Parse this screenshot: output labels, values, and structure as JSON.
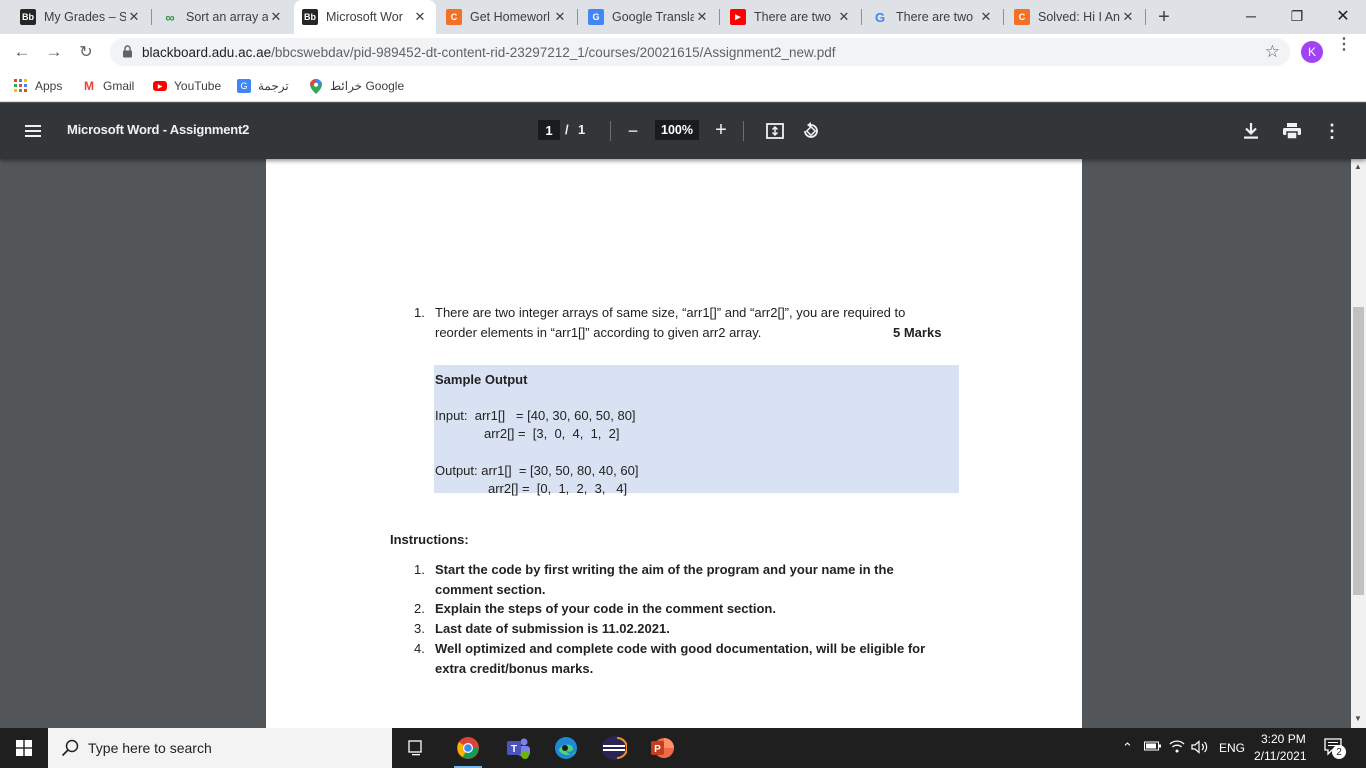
{
  "tabs": [
    {
      "title": "My Grades – S",
      "favicon": "Bb",
      "favicon_color": "#262626"
    },
    {
      "title": "Sort an array a",
      "favicon": "∞",
      "favicon_color": "#2f8d46"
    },
    {
      "title": "Microsoft Wor",
      "favicon": "Bb",
      "favicon_color": "#262626",
      "active": true
    },
    {
      "title": "Get Homeworl",
      "favicon": "C",
      "favicon_color": "#f37024"
    },
    {
      "title": "Google Transla",
      "favicon": "G",
      "favicon_color": "#4285f4"
    },
    {
      "title": "There are two",
      "favicon": "▶",
      "favicon_color": "#ff0000"
    },
    {
      "title": "There are two",
      "favicon": "G",
      "favicon_color": "#4285f4"
    },
    {
      "title": "Solved: Hi I An",
      "favicon": "C",
      "favicon_color": "#f37024"
    }
  ],
  "toolbar": {
    "url_host": "blackboard.adu.ac.ae",
    "url_path": "/bbcswebdav/pid-989452-dt-content-rid-23297212_1/courses/20021615/Assignment2_new.pdf",
    "profile_initial": "K"
  },
  "bookmarks": [
    {
      "label": "Apps",
      "icon": "apps-grid-icon"
    },
    {
      "label": "Gmail",
      "icon": "gmail-icon"
    },
    {
      "label": "YouTube",
      "icon": "youtube-icon"
    },
    {
      "label": "ترجمة",
      "icon": "google-translate-icon"
    },
    {
      "label": "خرائط Google",
      "icon": "google-maps-icon"
    }
  ],
  "pdf": {
    "title": "Microsoft Word - Assignment2",
    "current_page": "1",
    "page_sep": "/",
    "total_pages": "1",
    "zoom": "100%"
  },
  "document": {
    "q_number": "1.",
    "q_line1": "There are two integer arrays of same size, “arr1[]” and “arr2[]”, you are required to",
    "q_line2": "reorder elements in “arr1[]” according to given arr2 array.",
    "marks": "5 Marks",
    "sample_title": "Sample Output",
    "input_line1": "Input:  arr1[]   = [40, 30, 60, 50, 80]",
    "input_line2": "arr2[] =  [3,  0,  4,  1,  2]",
    "output_line1": "Output: arr1[]  = [30, 50, 80, 40, 60]",
    "output_line2": "arr2[] =  [0,  1,  2,  3,   4]",
    "instructions_heading": "Instructions:",
    "instructions": [
      {
        "num": "1.",
        "line1": "Start the code by first writing the aim of the program and your name in the",
        "line2": "comment section."
      },
      {
        "num": "2.",
        "line1": "Explain the steps of your code in the comment section.",
        "line2": ""
      },
      {
        "num": "3.",
        "line1": "Last date of submission is 11.02.2021.",
        "line2": ""
      },
      {
        "num": "4.",
        "line1": "Well optimized and complete code with good documentation, will be eligible for",
        "line2": "extra credit/bonus marks."
      }
    ]
  },
  "taskbar": {
    "search_placeholder": "Type here to search",
    "language": "ENG",
    "time": "3:20 PM",
    "date": "2/11/2021",
    "notification_count": "2"
  }
}
